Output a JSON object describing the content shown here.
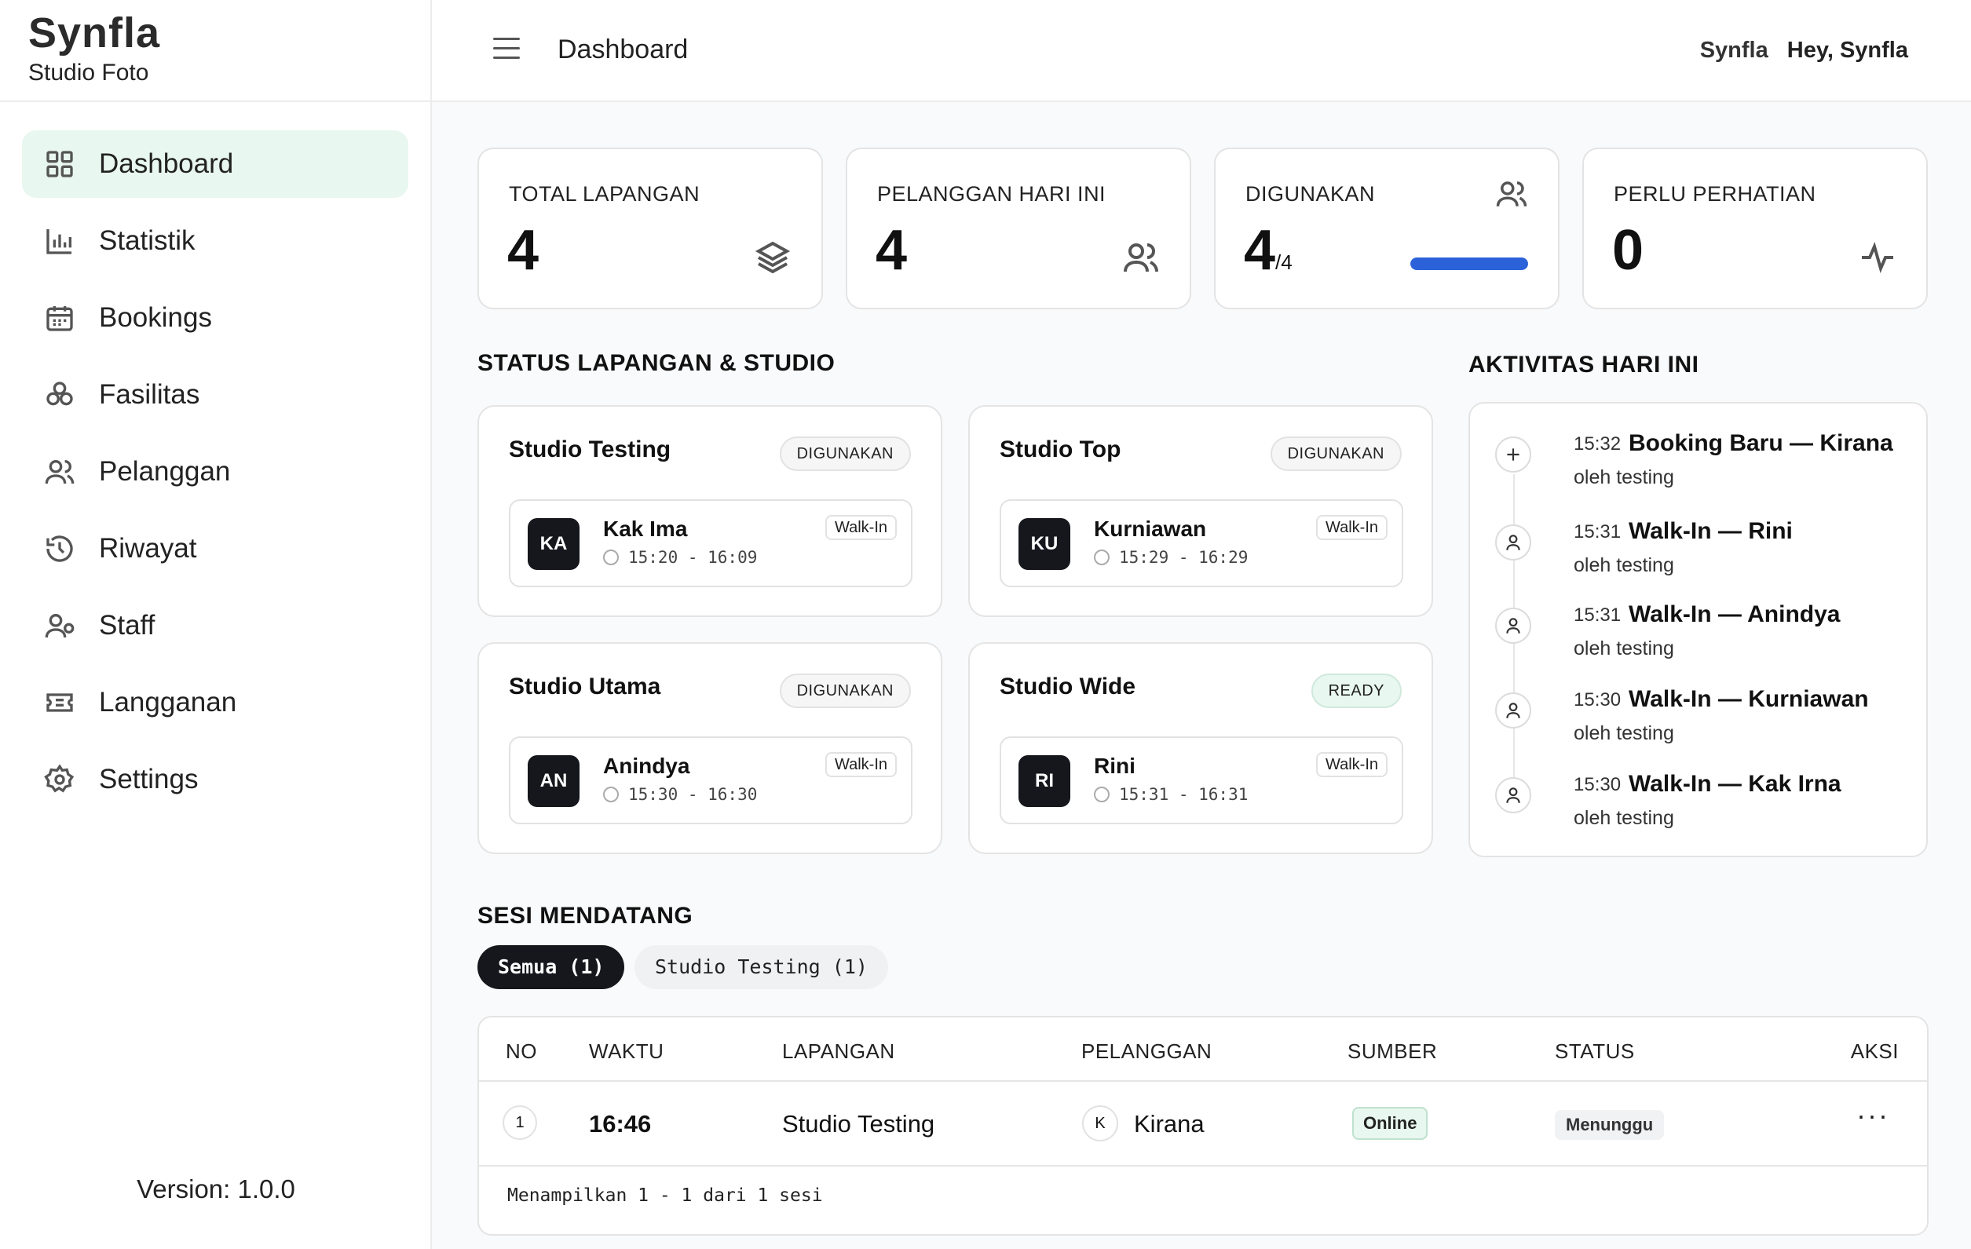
{
  "brand": {
    "logo": "Synfla",
    "subtitle": "Studio Foto"
  },
  "sidebar": {
    "items": [
      {
        "label": "Dashboard",
        "icon": "grid-icon",
        "active": true
      },
      {
        "label": "Statistik",
        "icon": "bar-chart-icon"
      },
      {
        "label": "Bookings",
        "icon": "calendar-icon"
      },
      {
        "label": "Fasilitas",
        "icon": "cubes-icon"
      },
      {
        "label": "Pelanggan",
        "icon": "users-icon"
      },
      {
        "label": "Riwayat",
        "icon": "history-icon"
      },
      {
        "label": "Staff",
        "icon": "staff-icon"
      },
      {
        "label": "Langganan",
        "icon": "ticket-icon"
      },
      {
        "label": "Settings",
        "icon": "gear-icon"
      }
    ],
    "version": "Version: 1.0.0"
  },
  "header": {
    "title": "Dashboard",
    "logo_small": "Synfla",
    "greeting": "Hey, Synfla"
  },
  "stats": [
    {
      "label": "TOTAL LAPANGAN",
      "value": "4",
      "icon": "layers-icon"
    },
    {
      "label": "PELANGGAN HARI INI",
      "value": "4",
      "icon": "users-icon"
    },
    {
      "label": "DIGUNAKAN",
      "value": "4",
      "sub": "/4",
      "icon": "users-icon",
      "progress": 1.0
    },
    {
      "label": "PERLU PERHATIAN",
      "value": "0",
      "icon": "activity-icon"
    }
  ],
  "status_section": {
    "title": "STATUS LAPANGAN & STUDIO"
  },
  "studios": [
    {
      "name": "Studio Testing",
      "status": "DIGUNAKAN",
      "initials": "KA",
      "customer": "Kak Ima",
      "time": "15:20 - 16:09",
      "tag": "Walk-In"
    },
    {
      "name": "Studio Top",
      "status": "DIGUNAKAN",
      "initials": "KU",
      "customer": "Kurniawan",
      "time": "15:29 - 16:29",
      "tag": "Walk-In"
    },
    {
      "name": "Studio Utama",
      "status": "DIGUNAKAN",
      "initials": "AN",
      "customer": "Anindya",
      "time": "15:30 - 16:30",
      "tag": "Walk-In"
    },
    {
      "name": "Studio Wide",
      "status": "READY",
      "initials": "RI",
      "customer": "Rini",
      "time": "15:31 - 16:31",
      "tag": "Walk-In"
    }
  ],
  "activity": {
    "title": "AKTIVITAS HARI INI",
    "items": [
      {
        "time": "15:32",
        "title": "Booking Baru — Kirana",
        "by": "oleh testing",
        "icon": "plus-icon"
      },
      {
        "time": "15:31",
        "title": "Walk-In — Rini",
        "by": "oleh testing",
        "icon": "user-icon"
      },
      {
        "time": "15:31",
        "title": "Walk-In — Anindya",
        "by": "oleh testing",
        "icon": "user-icon"
      },
      {
        "time": "15:30",
        "title": "Walk-In — Kurniawan",
        "by": "oleh testing",
        "icon": "user-icon"
      },
      {
        "time": "15:30",
        "title": "Walk-In — Kak Irna",
        "by": "oleh testing",
        "icon": "user-icon"
      }
    ]
  },
  "sessions": {
    "title": "SESI MENDATANG",
    "tabs": [
      {
        "label": "Semua (1)",
        "active": true
      },
      {
        "label": "Studio Testing (1)"
      }
    ],
    "columns": [
      "NO",
      "WAKTU",
      "LAPANGAN",
      "PELANGGAN",
      "SUMBER",
      "STATUS",
      "AKSI"
    ],
    "rows": [
      {
        "no": "1",
        "time": "16:46",
        "field": "Studio Testing",
        "initial": "K",
        "customer": "Kirana",
        "source": "Online",
        "status": "Menunggu",
        "action": "···"
      }
    ],
    "footer": "Menampilkan 1 - 1 dari 1 sesi"
  }
}
